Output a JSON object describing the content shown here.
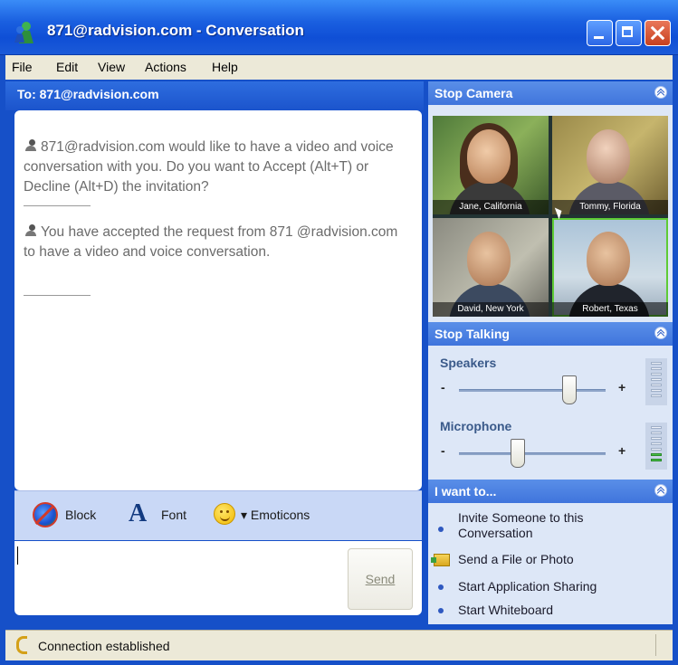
{
  "window": {
    "title": "871@radvision.com - Conversation"
  },
  "menu": [
    "File",
    "Edit",
    "View",
    "Actions",
    "Help"
  ],
  "conversation": {
    "to_label": "To:  871@radvision.com",
    "messages": [
      "871@radvision.com would like to have a video and voice conversation with you. Do you want to Accept (Alt+T) or Decline (Alt+D) the invitation?",
      "You have accepted the request from 871 @radvision.com to have a video and voice conversation."
    ]
  },
  "toolbar": {
    "block_label": "Block",
    "font_label": "Font",
    "emoticons_label": "▾ Emoticons"
  },
  "compose": {
    "send_label": "Send"
  },
  "camera": {
    "header": "Stop Camera",
    "participants": [
      "Jane, California",
      "Tommy, Florida",
      "David, New York",
      "Robert, Texas"
    ]
  },
  "audio": {
    "header": "Stop Talking",
    "speakers_label": "Speakers",
    "microphone_label": "Microphone",
    "speakers_level": 0.75,
    "microphone_level": 0.4
  },
  "tasks": {
    "header": "I want to...",
    "items": [
      "Invite Someone to this Conversation",
      "Send a File or Photo",
      "Start Application Sharing",
      "Start Whiteboard"
    ]
  },
  "status": {
    "text": "Connection established"
  }
}
